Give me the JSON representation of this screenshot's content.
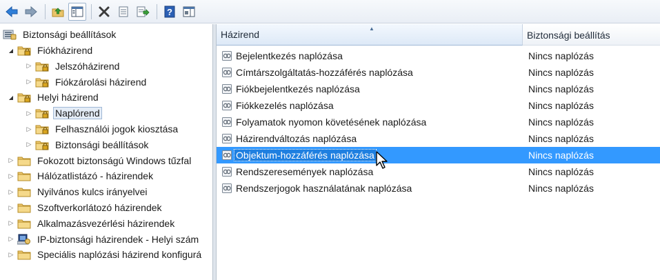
{
  "toolbar": {
    "buttons": [
      {
        "name": "back-button",
        "icon": "back-arrow-icon"
      },
      {
        "name": "forward-button",
        "icon": "forward-arrow-icon"
      },
      {
        "name": "up-folder-button",
        "icon": "up-folder-icon"
      },
      {
        "name": "show-hide-tree-button",
        "icon": "console-tree-icon"
      },
      {
        "name": "delete-button",
        "icon": "delete-x-icon"
      },
      {
        "name": "properties-button",
        "icon": "properties-icon"
      },
      {
        "name": "export-list-button",
        "icon": "export-list-icon"
      },
      {
        "name": "help-button",
        "icon": "help-icon"
      },
      {
        "name": "action-pane-button",
        "icon": "action-pane-icon"
      }
    ]
  },
  "tree": {
    "root": "Biztonsági beállítások",
    "items": [
      {
        "label": "Fiókházirend",
        "level": 1,
        "expanded": true
      },
      {
        "label": "Jelszóházirend",
        "level": 2
      },
      {
        "label": "Fiókzárolási házirend",
        "level": 2
      },
      {
        "label": "Helyi házirend",
        "level": 1,
        "expanded": true
      },
      {
        "label": "Naplórend",
        "level": 2,
        "selected": true
      },
      {
        "label": "Felhasználói jogok kiosztása",
        "level": 2
      },
      {
        "label": "Biztonsági beállítások",
        "level": 2
      },
      {
        "label": "Fokozott biztonságú Windows tűzfal",
        "level": 1
      },
      {
        "label": "Hálózatlistázó - házirendek",
        "level": 1
      },
      {
        "label": "Nyilvános kulcs irányelvei",
        "level": 1
      },
      {
        "label": "Szoftverkorlátozó házirendek",
        "level": 1
      },
      {
        "label": "Alkalmazásvezérlési házirendek",
        "level": 1
      },
      {
        "label": "IP-biztonsági házirendek - Helyi szám",
        "level": 1
      },
      {
        "label": "Speciális naplózási házirend konfigurá",
        "level": 1
      }
    ]
  },
  "list": {
    "columns": {
      "policy": "Házirend",
      "setting": "Biztonsági beállítás"
    },
    "rows": [
      {
        "policy": "Bejelentkezés naplózása",
        "setting": "Nincs naplózás"
      },
      {
        "policy": "Címtárszolgáltatás-hozzáférés naplózása",
        "setting": "Nincs naplózás"
      },
      {
        "policy": "Fiókbejelentkezés naplózása",
        "setting": "Nincs naplózás"
      },
      {
        "policy": "Fiókkezelés naplózása",
        "setting": "Nincs naplózás"
      },
      {
        "policy": "Folyamatok nyomon követésének naplózása",
        "setting": "Nincs naplózás"
      },
      {
        "policy": "Házirendváltozás naplózása",
        "setting": "Nincs naplózás"
      },
      {
        "policy": "Objektum-hozzáférés naplózása",
        "setting": "Nincs naplózás",
        "selected": true
      },
      {
        "policy": "Rendszeresemények naplózása",
        "setting": "Nincs naplózás"
      },
      {
        "policy": "Rendszerjogok használatának naplózása",
        "setting": "Nincs naplózás"
      }
    ]
  },
  "colors": {
    "selection": "#3399ff",
    "folder": "#e9c46a",
    "toolbar_bg": "#eef2f7"
  }
}
